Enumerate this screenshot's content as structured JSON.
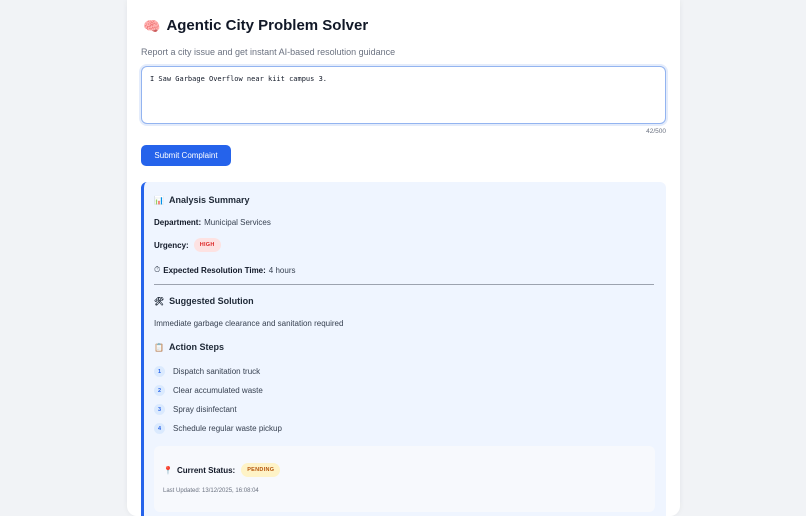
{
  "header": {
    "icon": "brain-icon",
    "title": "Agentic City Problem Solver",
    "subtitle": "Report a city issue and get instant AI-based resolution guidance"
  },
  "complaint": {
    "text": "I Saw Garbage Overflow near kiit campus 3.",
    "char_count": "42/500"
  },
  "submit_label": "Submit Complaint",
  "analysis": {
    "heading": "Analysis Summary",
    "department_label": "Department:",
    "department_value": "Municipal Services",
    "urgency_label": "Urgency:",
    "urgency_value": "HIGH",
    "time_label": "Expected Resolution Time:",
    "time_value": "4 hours"
  },
  "solution": {
    "heading": "Suggested Solution",
    "text": "Immediate garbage clearance and sanitation required"
  },
  "actions": {
    "heading": "Action Steps",
    "steps": [
      {
        "num": "1",
        "text": "Dispatch sanitation truck"
      },
      {
        "num": "2",
        "text": "Clear accumulated waste"
      },
      {
        "num": "3",
        "text": "Spray disinfectant"
      },
      {
        "num": "4",
        "text": "Schedule regular waste pickup"
      }
    ]
  },
  "status": {
    "label": "Current Status:",
    "value": "PENDING",
    "updated": "Last Updated: 13/12/2025, 16:08:04"
  },
  "colors": {
    "accent": "#2563eb",
    "high": "#dc2626",
    "pending": "#b45309"
  }
}
